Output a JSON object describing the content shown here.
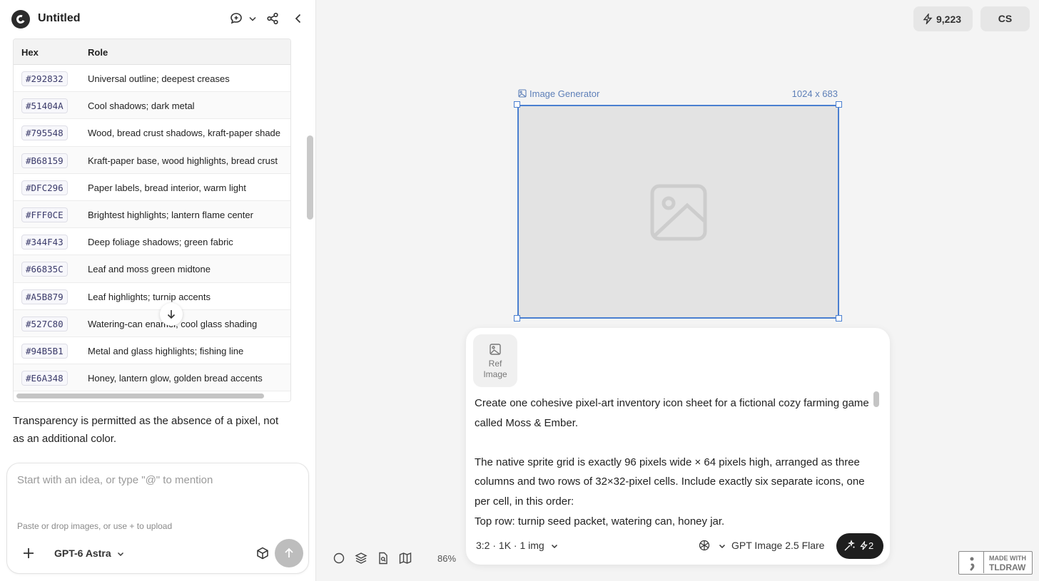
{
  "header": {
    "title": "Untitled"
  },
  "palette_table": {
    "columns": [
      "Hex",
      "Role"
    ],
    "rows": [
      {
        "hex": "#292832",
        "role": "Universal outline; deepest creases"
      },
      {
        "hex": "#51404A",
        "role": "Cool shadows; dark metal"
      },
      {
        "hex": "#795548",
        "role": "Wood, bread crust shadows, kraft-paper shade"
      },
      {
        "hex": "#B68159",
        "role": "Kraft-paper base, wood highlights, bread crust"
      },
      {
        "hex": "#DFC296",
        "role": "Paper labels, bread interior, warm light"
      },
      {
        "hex": "#FFF0CE",
        "role": "Brightest highlights; lantern flame center"
      },
      {
        "hex": "#344F43",
        "role": "Deep foliage shadows; green fabric"
      },
      {
        "hex": "#66835C",
        "role": "Leaf and moss green midtone"
      },
      {
        "hex": "#A5B879",
        "role": "Leaf highlights; turnip accents"
      },
      {
        "hex": "#527C80",
        "role": "Watering-can enamel; cool glass shading"
      },
      {
        "hex": "#94B5B1",
        "role": "Metal and glass highlights; fishing line"
      },
      {
        "hex": "#E6A348",
        "role": "Honey, lantern glow, golden bread accents"
      }
    ]
  },
  "message": {
    "transparency_note": "Transparency is permitted as the absence of a pixel, not as an additional color."
  },
  "chat": {
    "placeholder": "Start with an idea, or type \"@\" to mention",
    "hint": "Paste or drop images, or use + to upload",
    "model": "GPT-6 Astra"
  },
  "top_right": {
    "credits": "9,223",
    "user_initials": "CS"
  },
  "frame": {
    "label": "Image Generator",
    "size": "1024 x 683"
  },
  "generator": {
    "ref_label_1": "Ref",
    "ref_label_2": "Image",
    "prompt_p1": "Create one cohesive pixel-art inventory icon sheet for a fictional cozy farming game called Moss & Ember.",
    "prompt_p2": "The native sprite grid is exactly 96 pixels wide × 64 pixels high, arranged as three columns and two rows of 32×32-pixel cells. Include exactly six separate icons, one per cell, in this order:",
    "prompt_p3": "Top row: turnip seed packet, watering can, honey jar.",
    "settings": "3:2 · 1K · 1 img",
    "model": "GPT Image 2.5 Flare",
    "generate_cost": "2"
  },
  "canvas": {
    "zoom": "86%"
  },
  "watermark": {
    "line1": "MADE WITH",
    "line2": "TLDRAW"
  },
  "colors": {
    "accent": "#4a7fd0",
    "frame_fill": "#e3e3e3",
    "button_dark": "#1e1e1e"
  }
}
